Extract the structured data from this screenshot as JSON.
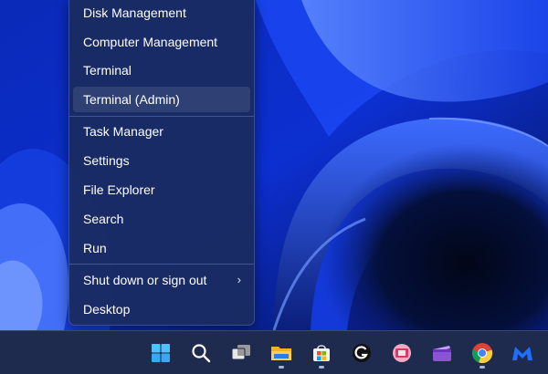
{
  "menu": {
    "items": [
      {
        "label": "Disk Management"
      },
      {
        "label": "Computer Management"
      },
      {
        "label": "Terminal"
      },
      {
        "label": "Terminal (Admin)"
      },
      {
        "label": "Task Manager"
      },
      {
        "label": "Settings"
      },
      {
        "label": "File Explorer"
      },
      {
        "label": "Search"
      },
      {
        "label": "Run"
      },
      {
        "label": "Shut down or sign out",
        "submenu_icon": "chevron-right-icon"
      },
      {
        "label": "Desktop"
      }
    ],
    "highlighted_item": "Terminal (Admin)"
  },
  "taskbar": {
    "apps": [
      {
        "icon": "windows-start-icon"
      },
      {
        "icon": "search-icon"
      },
      {
        "icon": "task-view-icon"
      },
      {
        "icon": "file-explorer-icon",
        "running": true
      },
      {
        "icon": "microsoft-store-icon",
        "running": true
      },
      {
        "icon": "logitech-g-hub-icon"
      },
      {
        "icon": "snipping-tool-icon"
      },
      {
        "icon": "clipchamp-icon"
      },
      {
        "icon": "chrome-icon",
        "running": true
      },
      {
        "icon": "malwarebytes-icon"
      }
    ]
  },
  "colors": {
    "menu_background": "#1a2c60",
    "taskbar_background": "#1e2a4e",
    "wallpaper_accent": "#2f62ff",
    "text": "#ffffff"
  }
}
